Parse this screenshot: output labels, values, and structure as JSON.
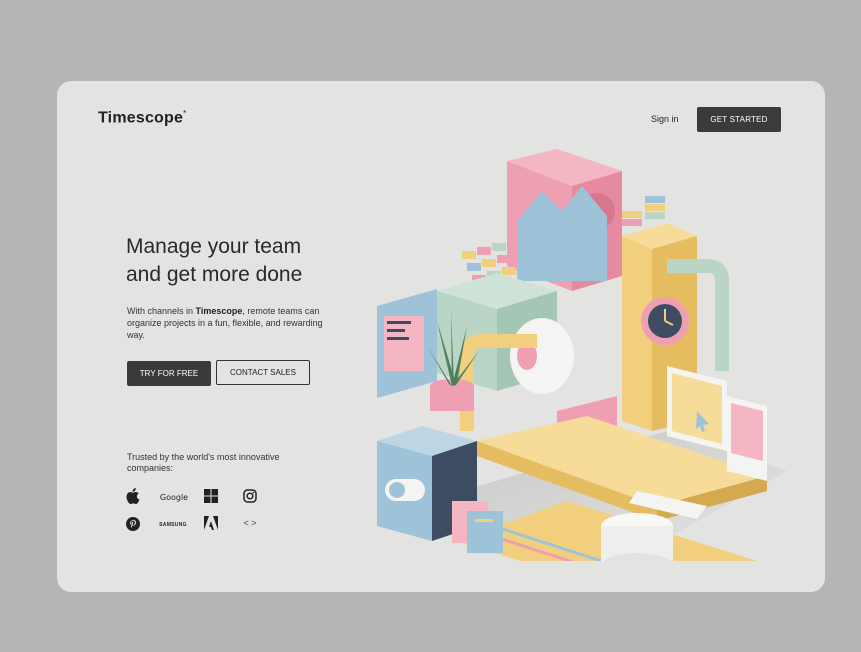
{
  "brand": {
    "name": "Timescope",
    "mark": "*"
  },
  "nav": {
    "signin_label": "Sign in",
    "cta_label": "GET STARTED"
  },
  "hero": {
    "headline_line1": "Manage your team",
    "headline_line2": "and get more done",
    "sub_pre": "With channels in ",
    "sub_brand": "Timescope",
    "sub_post": ", remote teams can organize projects in a fun, flexible, and rewarding way.",
    "primary_label": "TRY FOR FREE",
    "secondary_label": "CONTACT SALES"
  },
  "trust": {
    "text": "Trusted by the world's most innovative companies:",
    "logos": {
      "google": "Google",
      "samsung": "SAMSUNG",
      "code": "< >"
    }
  },
  "colors": {
    "background": "#b5b5b5",
    "card": "#e3e3e2",
    "primary": "#3a3a3a",
    "pink": "#ee9fb1",
    "yellow": "#f1cf7c",
    "blue": "#9ec3d8",
    "mint": "#b9d5c6"
  },
  "icons": [
    "apple-icon",
    "windows-icon",
    "instagram-icon",
    "pinterest-icon",
    "adobe-icon"
  ]
}
